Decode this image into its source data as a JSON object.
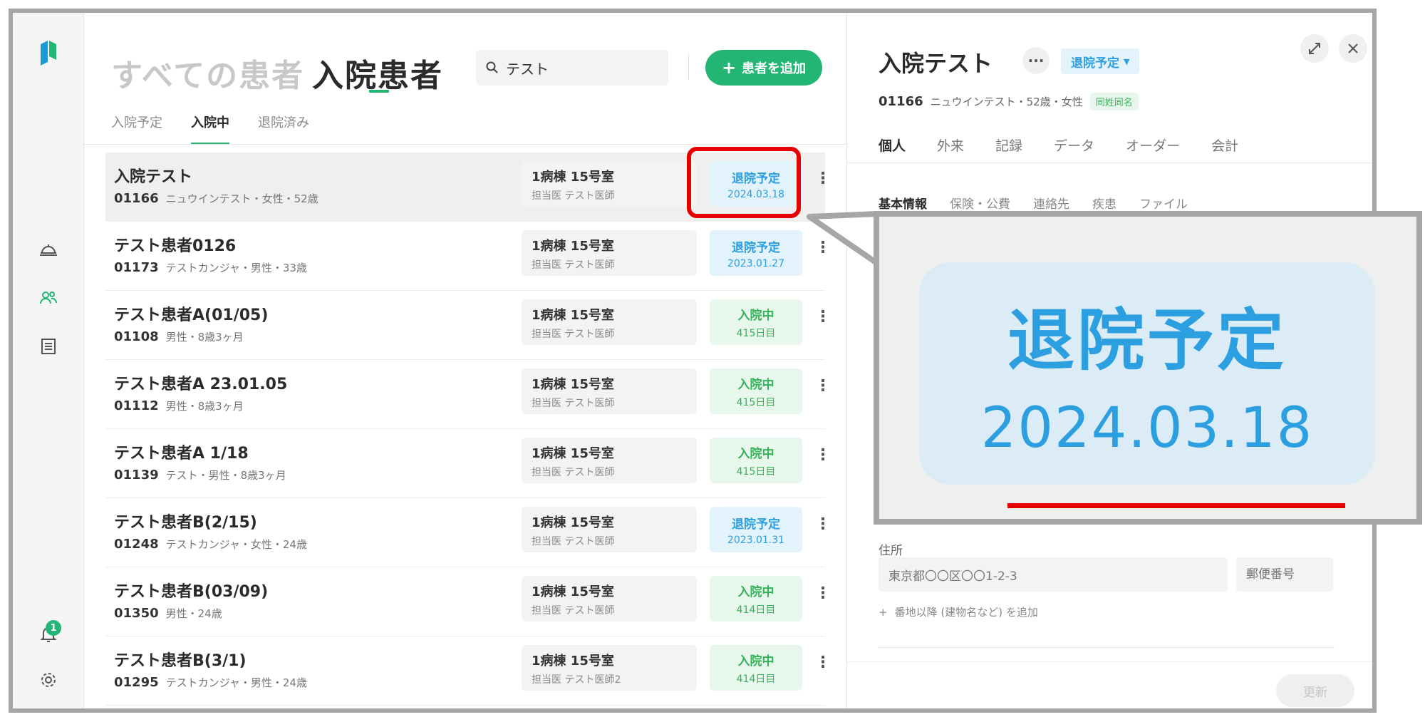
{
  "list": {
    "title_all": "すべての患者",
    "title_inpatient": "入院患者",
    "search_value": "テスト",
    "add_button": "患者を追加",
    "tabs": [
      "入院予定",
      "入院中",
      "退院済み"
    ],
    "active_tab": "入院中"
  },
  "rail": {
    "notification_count": "1"
  },
  "patients": [
    {
      "name": "入院テスト",
      "id": "01166",
      "info": "ニュウインテスト・女性・52歳",
      "room": "1病棟 15号室",
      "doctor": "担当医 テスト医師",
      "status": "退院予定",
      "status_sub": "2024.03.18",
      "status_color": "#2c9fe0"
    },
    {
      "name": "テスト患者0126",
      "id": "01173",
      "info": "テストカンジャ・男性・33歳",
      "room": "1病棟 15号室",
      "doctor": "担当医 テスト医師",
      "status": "退院予定",
      "status_sub": "2023.01.27",
      "status_color": "#2c9fe0"
    },
    {
      "name": "テスト患者A(01/05)",
      "id": "01108",
      "info": "男性・8歳3ヶ月",
      "room": "1病棟 15号室",
      "doctor": "担当医 テスト医師",
      "status": "入院中",
      "status_sub": "415日目",
      "status_color": "#35b35a"
    },
    {
      "name": "テスト患者A 23.01.05",
      "id": "01112",
      "info": "男性・8歳3ヶ月",
      "room": "1病棟 15号室",
      "doctor": "担当医 テスト医師",
      "status": "入院中",
      "status_sub": "415日目",
      "status_color": "#35b35a"
    },
    {
      "name": "テスト患者A 1/18",
      "id": "01139",
      "info": "テスト・男性・8歳3ヶ月",
      "room": "1病棟 15号室",
      "doctor": "担当医 テスト医師",
      "status": "入院中",
      "status_sub": "415日目",
      "status_color": "#35b35a"
    },
    {
      "name": "テスト患者B(2/15)",
      "id": "01248",
      "info": "テストカンジャ・女性・24歳",
      "room": "1病棟 15号室",
      "doctor": "担当医 テスト医師",
      "status": "退院予定",
      "status_sub": "2023.01.31",
      "status_color": "#2c9fe0"
    },
    {
      "name": "テスト患者B(03/09)",
      "id": "01350",
      "info": "男性・24歳",
      "room": "1病棟 15号室",
      "doctor": "担当医 テスト医師",
      "status": "入院中",
      "status_sub": "414日目",
      "status_color": "#35b35a"
    },
    {
      "name": "テスト患者B(3/1)",
      "id": "01295",
      "info": "テストカンジャ・男性・24歳",
      "room": "1病棟 15号室",
      "doctor": "担当医 テスト医師2",
      "status": "入院中",
      "status_sub": "414日目",
      "status_color": "#35b35a"
    }
  ],
  "detail": {
    "name": "入院テスト",
    "status": "退院予定",
    "id": "01166",
    "info": "ニュウインテスト・52歳・女性",
    "same_name_badge": "同姓同名",
    "tabs": [
      "個人",
      "外来",
      "記録",
      "データ",
      "オーダー",
      "会計"
    ],
    "subtabs": [
      "基本情報",
      "保険・公費",
      "連絡先",
      "疾患",
      "ファイル"
    ],
    "address_label": "住所",
    "address_value": "東京都〇〇区〇〇1-2-3",
    "zip_placeholder": "郵便番号",
    "add_address_line": "番地以降 (建物名など) を追加",
    "update_button": "更新"
  },
  "zoom": {
    "label": "退院予定",
    "date": "2024.03.18"
  }
}
